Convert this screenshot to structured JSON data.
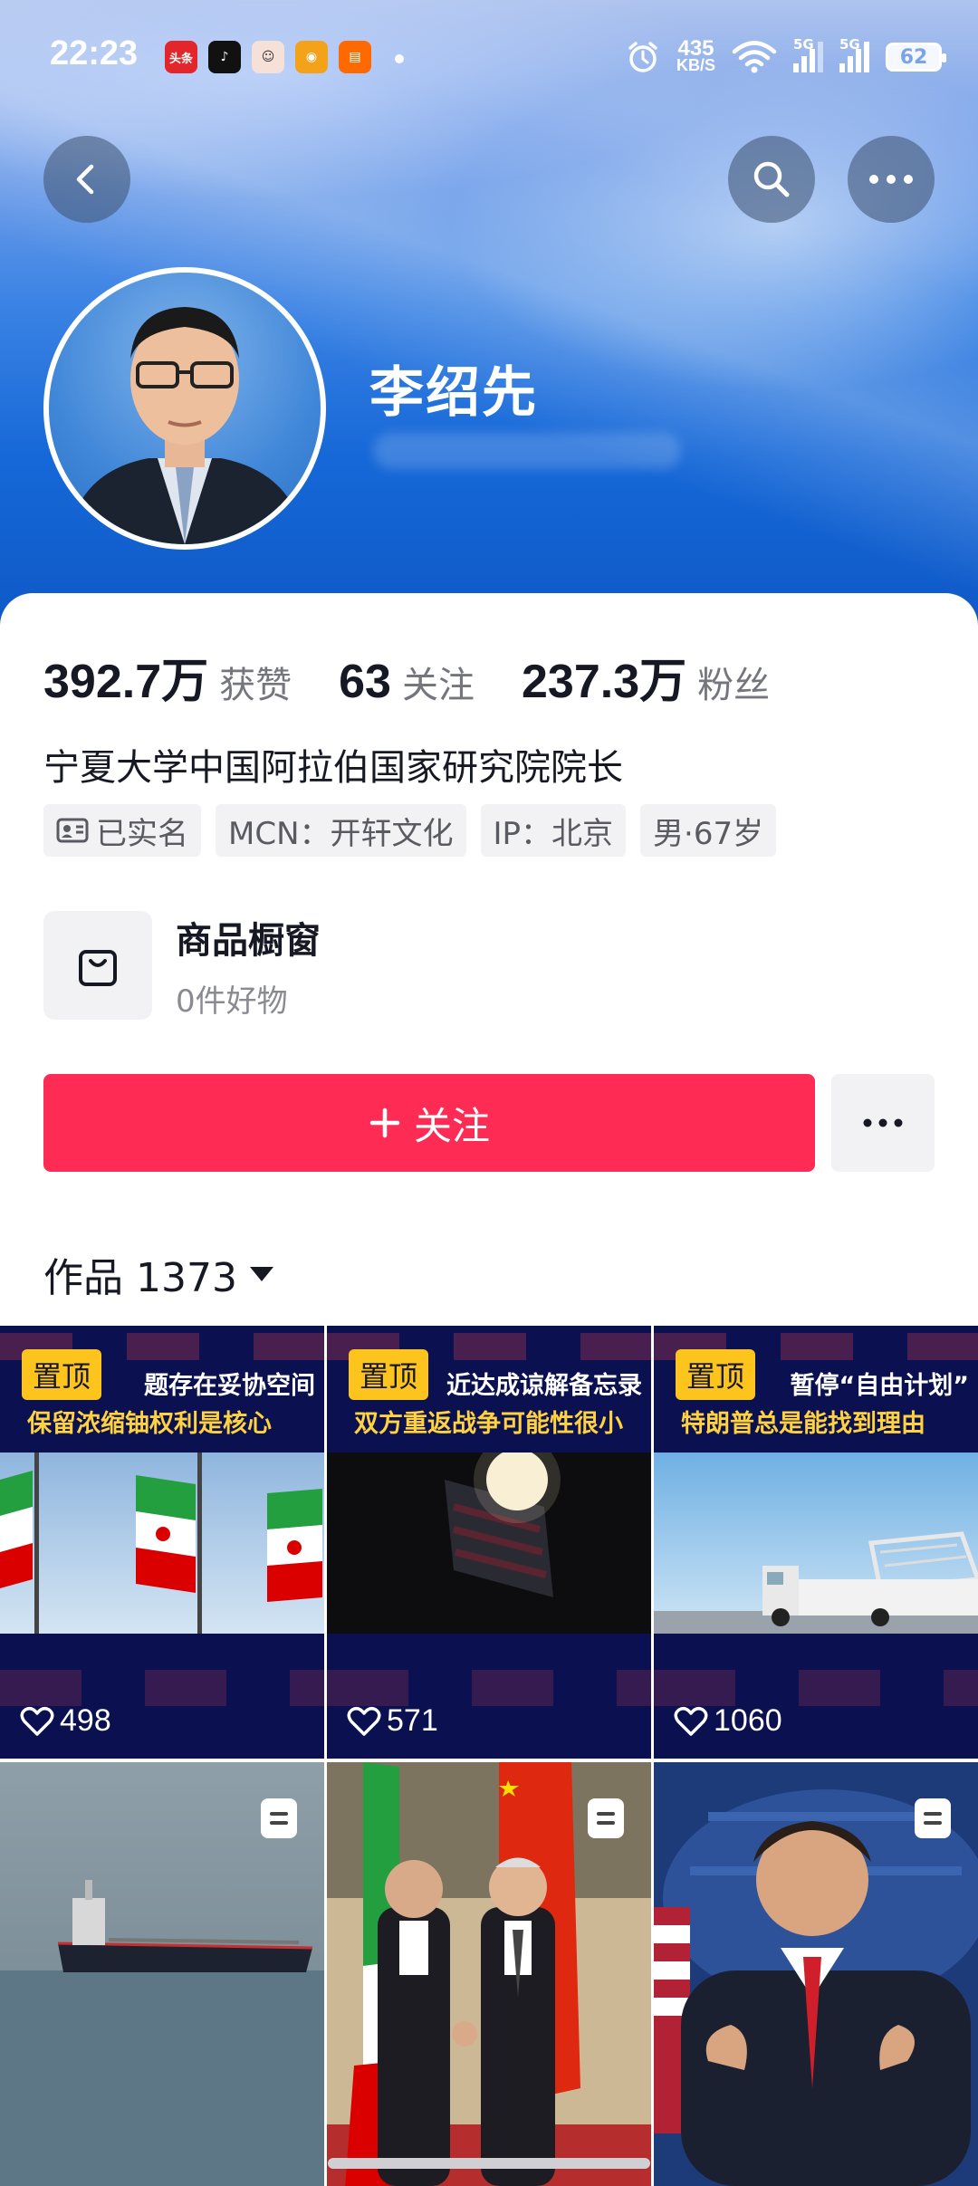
{
  "status_bar": {
    "time": "22:23",
    "apps": [
      "头条",
      "TikTok",
      "avatar-app",
      "weibo",
      "taobao"
    ],
    "net_speed_value": "435",
    "net_speed_unit": "KB/S",
    "signal_1": "5G",
    "signal_2": "5G",
    "battery": "62"
  },
  "header": {
    "username": "李绍先",
    "colors": {
      "primary": "#fe2c55",
      "header_blue": "#1668d8"
    }
  },
  "stats": [
    {
      "value": "392.7万",
      "label": "获赞"
    },
    {
      "value": "63",
      "label": "关注"
    },
    {
      "value": "237.3万",
      "label": "粉丝"
    }
  ],
  "bio": "宁夏大学中国阿拉伯国家研究院院长",
  "tags": {
    "verified": "已实名",
    "mcn": "MCN：开轩文化",
    "ip": "IP：北京",
    "gender_age": "男·67岁"
  },
  "shop": {
    "title": "商品橱窗",
    "subtitle": "0件好物"
  },
  "actions": {
    "follow_label": "关注"
  },
  "works": {
    "label": "作品 1373"
  },
  "videos": [
    {
      "pinned": "置顶",
      "headline_top": "题存在妥协空间",
      "headline_bottom": "保留浓缩铀权利是核心",
      "likes": "498"
    },
    {
      "pinned": "置顶",
      "headline_top": "近达成谅解备忘录",
      "headline_bottom": "双方重返战争可能性很小",
      "likes": "571"
    },
    {
      "pinned": "置顶",
      "headline_top": "暂停“自由计划”",
      "headline_bottom": "特朗普总是能找到理由",
      "likes": "1060"
    },
    {
      "type": "image-post"
    },
    {
      "type": "image-post"
    },
    {
      "type": "image-post"
    }
  ]
}
